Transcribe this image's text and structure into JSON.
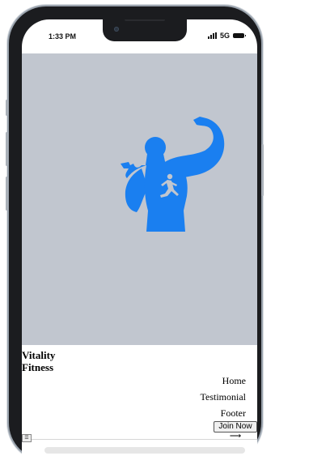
{
  "status_bar": {
    "time": "1:33 PM",
    "network": "5G",
    "signal_icon": "signal-icon",
    "battery_icon": "battery-icon"
  },
  "hero": {
    "image_icon": "flexing-muscle-silhouette-icon",
    "accent_color": "#1a7ff0",
    "background": "#c1c6cf"
  },
  "header": {
    "brand_line1": "Vitality",
    "brand_line2": "Fitness"
  },
  "nav": {
    "items": [
      "Home",
      "Testimonial",
      "Footer"
    ]
  },
  "cta": {
    "label": "Join Now ⟶"
  },
  "menu_toggle": {
    "label": "☰"
  }
}
